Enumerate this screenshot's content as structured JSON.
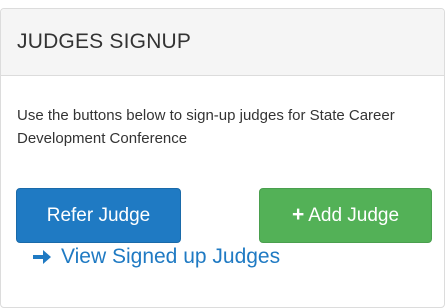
{
  "panel": {
    "title": "JUDGES SIGNUP",
    "intro_text": "Use the buttons below to sign-up judges for State Career Development Conference"
  },
  "buttons": {
    "refer_label": "Refer Judge",
    "add_label": "Add Judge",
    "add_icon": "plus-icon"
  },
  "link": {
    "view_label": "View Signed up Judges",
    "icon": "arrow-right-icon"
  },
  "colors": {
    "primary": "#1f7ac3",
    "success": "#53b157",
    "heading_bg": "#f5f5f5"
  }
}
